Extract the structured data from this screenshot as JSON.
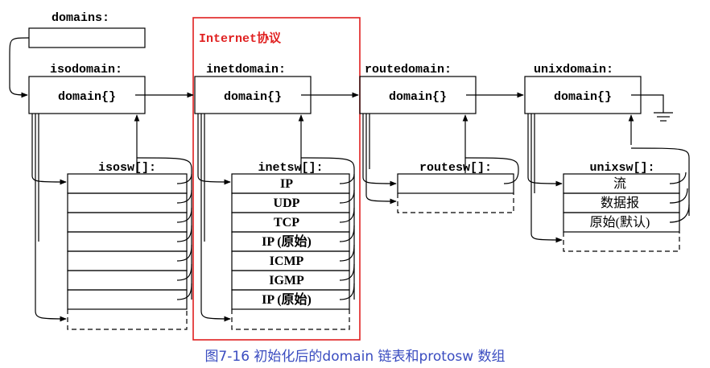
{
  "diagram": {
    "domains_label": "domains:",
    "internet_label": "Internet协议",
    "domain_headers": [
      "isodomain:",
      "inetdomain:",
      "routedomain:",
      "unixdomain:"
    ],
    "domain_struct": "domain{}",
    "arrays": {
      "iso": {
        "label": "isosw[]:",
        "entries": [
          "",
          "",
          "",
          "",
          "",
          "",
          ""
        ]
      },
      "inet": {
        "label": "inetsw[]:",
        "entries": [
          "IP",
          "UDP",
          "TCP",
          "IP (原始)",
          "ICMP",
          "IGMP",
          "IP (原始)"
        ]
      },
      "route": {
        "label": "routesw[]:",
        "entries": [
          ""
        ]
      },
      "unix": {
        "label": "unixsw[]:",
        "entries": [
          "流",
          "数据报",
          "原始(默认)"
        ]
      }
    }
  },
  "caption": "图7-16   初始化后的domain 链表和protosw 数组",
  "colors": {
    "line": "#000000",
    "highlight": "#e02020",
    "caption": "#3a4cc0"
  }
}
